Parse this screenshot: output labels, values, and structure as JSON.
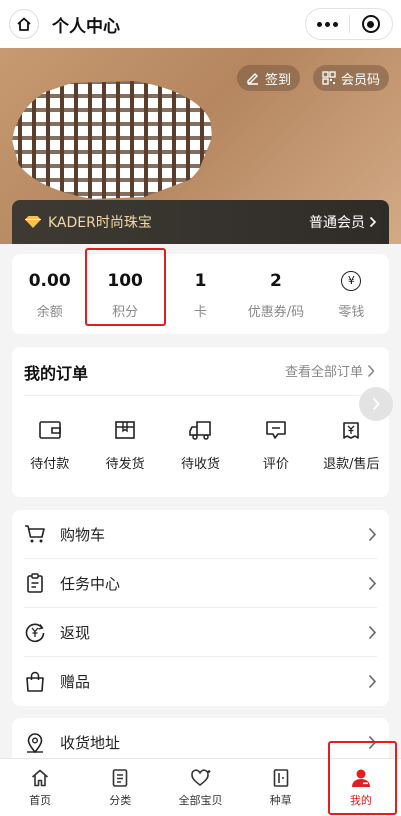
{
  "header": {
    "title": "个人中心",
    "home_icon": "home-icon",
    "more_icon": "more-dots-icon",
    "close_icon": "target-icon"
  },
  "hero": {
    "sign_in_label": "签到",
    "member_code_label": "会员码",
    "brand_name": "KADER时尚珠宝",
    "member_level": "普通会员"
  },
  "stats": [
    {
      "value": "0.00",
      "label": "余额"
    },
    {
      "value": "100",
      "label": "积分"
    },
    {
      "value": "1",
      "label": "卡"
    },
    {
      "value": "2",
      "label": "优惠券/码"
    },
    {
      "value": "¥",
      "label": "零钱"
    }
  ],
  "orders": {
    "title": "我的订单",
    "view_all": "查看全部订单",
    "items": [
      {
        "label": "待付款",
        "icon": "wallet-icon"
      },
      {
        "label": "待发货",
        "icon": "package-icon"
      },
      {
        "label": "待收货",
        "icon": "truck-icon"
      },
      {
        "label": "评价",
        "icon": "comment-icon"
      },
      {
        "label": "退款/售后",
        "icon": "refund-icon"
      }
    ]
  },
  "menu": [
    {
      "label": "购物车",
      "icon": "cart-icon"
    },
    {
      "label": "任务中心",
      "icon": "clipboard-icon"
    },
    {
      "label": "返现",
      "icon": "cashback-icon"
    },
    {
      "label": "赠品",
      "icon": "gift-bag-icon"
    }
  ],
  "address": {
    "label": "收货地址",
    "icon": "location-icon"
  },
  "tabbar": [
    {
      "label": "首页",
      "icon": "home-icon"
    },
    {
      "label": "分类",
      "icon": "category-icon"
    },
    {
      "label": "全部宝贝",
      "icon": "heart-sparkle-icon"
    },
    {
      "label": "种草",
      "icon": "door-icon"
    },
    {
      "label": "我的",
      "icon": "user-icon",
      "active": true
    }
  ],
  "colors": {
    "accent": "#e02020",
    "member_bar": "#3a3631",
    "member_gold": "#f2d8a8",
    "hero_bg": "#c49669"
  }
}
